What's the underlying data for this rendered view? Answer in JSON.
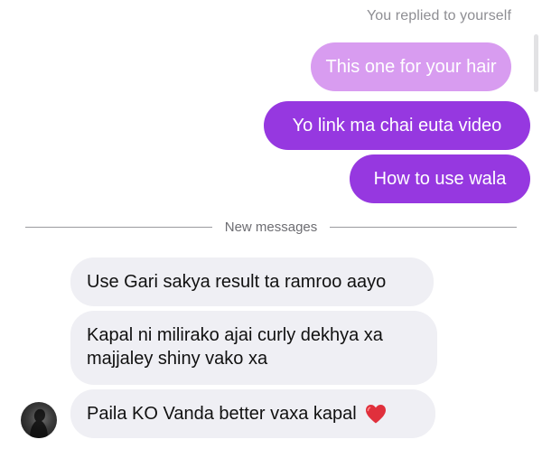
{
  "thread": {
    "reply_note": "You replied to yourself",
    "divider_label": "New messages"
  },
  "messages": {
    "outgoing": [
      {
        "text": "This one for your hair",
        "style": "reply-preview",
        "color": "#d89cf0"
      },
      {
        "text": "Yo link ma chai euta video",
        "color": "#9638e0"
      },
      {
        "text": "How to use wala",
        "color": "#9638e0"
      }
    ],
    "incoming": [
      {
        "text": "Use Gari sakya result ta ramroo aayo"
      },
      {
        "text": "Kapal ni milirako ajai curly dekhya xa majjaley shiny vako xa"
      },
      {
        "text": "Paila KO Vanda better vaxa kapal",
        "emoji": "heart-icon"
      }
    ]
  },
  "colors": {
    "incoming_bubble": "#efeff4",
    "outgoing_bubble": "#9638e0",
    "reply_bubble": "#d89cf0"
  }
}
